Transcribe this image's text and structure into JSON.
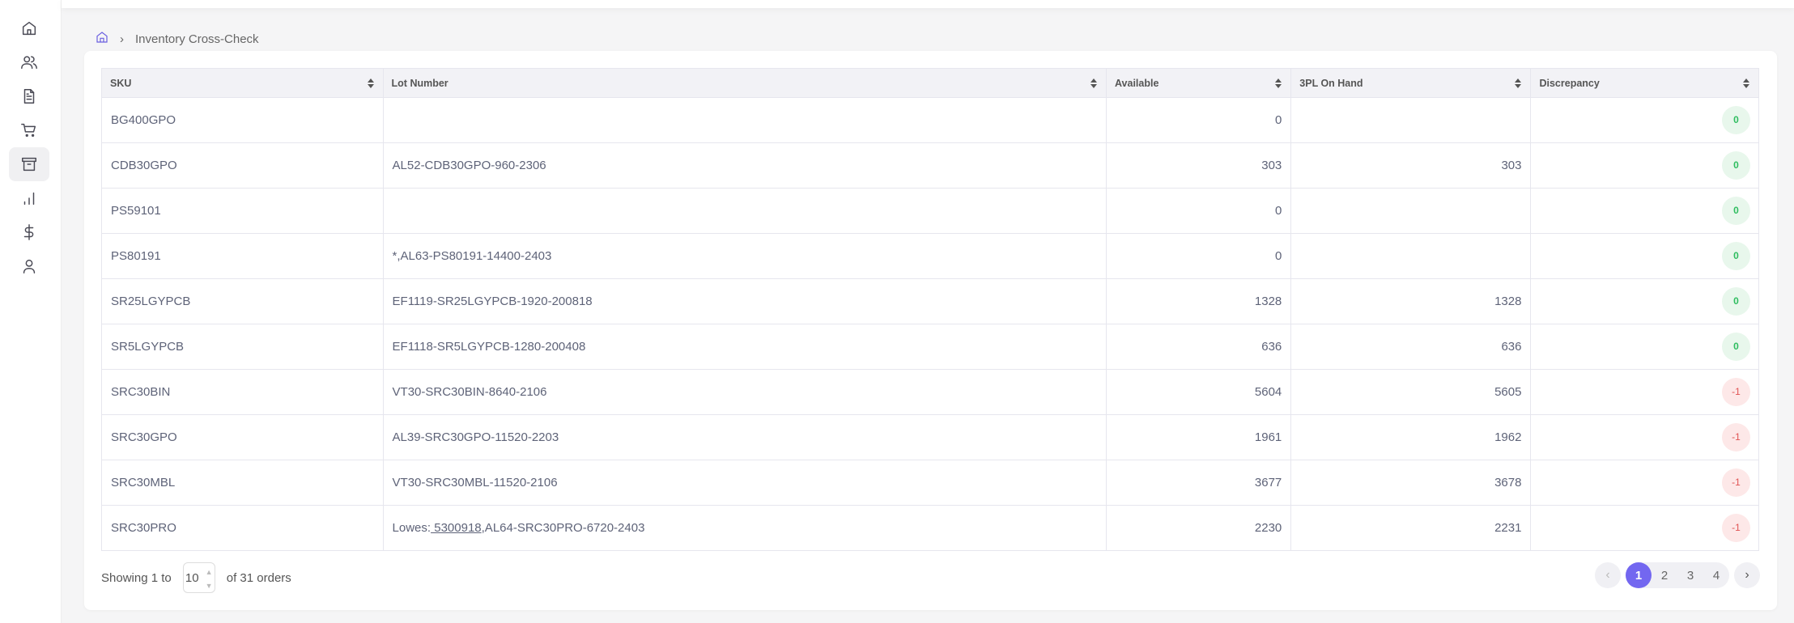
{
  "sidebar": {
    "items": [
      {
        "icon": "home-icon",
        "active": false
      },
      {
        "icon": "users-icon",
        "active": false
      },
      {
        "icon": "document-icon",
        "active": false
      },
      {
        "icon": "cart-icon",
        "active": false
      },
      {
        "icon": "archive-icon",
        "active": true
      },
      {
        "icon": "bar-chart-icon",
        "active": false
      },
      {
        "icon": "dollar-icon",
        "active": false
      },
      {
        "icon": "user-icon",
        "active": false
      }
    ]
  },
  "breadcrumb": {
    "current": "Inventory Cross-Check"
  },
  "table": {
    "columns": [
      "SKU",
      "Lot Number",
      "Available",
      "3PL On Hand",
      "Discrepancy"
    ],
    "rows": [
      {
        "sku": "BG400GPO",
        "lot": "",
        "available": "0",
        "onhand": "",
        "disc": "0"
      },
      {
        "sku": "CDB30GPO",
        "lot": "AL52-CDB30GPO-960-2306",
        "available": "303",
        "onhand": "303",
        "disc": "0"
      },
      {
        "sku": "PS59101",
        "lot": "",
        "available": "0",
        "onhand": "",
        "disc": "0"
      },
      {
        "sku": "PS80191",
        "lot": "*,AL63-PS80191-14400-2403",
        "available": "0",
        "onhand": "",
        "disc": "0"
      },
      {
        "sku": "SR25LGYPCB",
        "lot": "EF1119-SR25LGYPCB-1920-200818",
        "available": "1328",
        "onhand": "1328",
        "disc": "0"
      },
      {
        "sku": "SR5LGYPCB",
        "lot": "EF1118-SR5LGYPCB-1280-200408",
        "available": "636",
        "onhand": "636",
        "disc": "0"
      },
      {
        "sku": "SRC30BIN",
        "lot": "VT30-SRC30BIN-8640-2106",
        "available": "5604",
        "onhand": "5605",
        "disc": "-1"
      },
      {
        "sku": "SRC30GPO",
        "lot": "AL39-SRC30GPO-11520-2203",
        "available": "1961",
        "onhand": "1962",
        "disc": "-1"
      },
      {
        "sku": "SRC30MBL",
        "lot": "VT30-SRC30MBL-11520-2106",
        "available": "3677",
        "onhand": "3678",
        "disc": "-1"
      },
      {
        "sku": "SRC30PRO",
        "lot_prefix": "Lowes:",
        "lot_link": " 5300918",
        "lot_suffix": ",AL64-SRC30PRO-6720-2403",
        "available": "2230",
        "onhand": "2231",
        "disc": "-1"
      }
    ]
  },
  "footer": {
    "showing": "Showing 1 to",
    "page_size": "10",
    "total": "of 31 orders"
  },
  "pagination": {
    "pages": [
      "1",
      "2",
      "3",
      "4"
    ],
    "current": "1",
    "prev": "‹",
    "next": "›"
  },
  "colors": {
    "accent": "#7367f0",
    "ok": "#2ebd5f",
    "bad": "#e05252"
  }
}
